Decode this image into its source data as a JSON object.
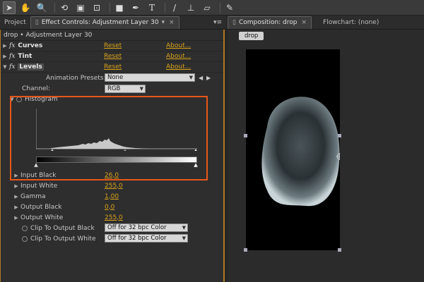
{
  "toolbar": {
    "tools": [
      "selection-tool-icon",
      "hand-tool-icon",
      "zoom-tool-icon",
      "rotate-tool-icon",
      "camera-tool-icon",
      "pan-behind-tool-icon",
      "rectangle-tool-icon",
      "pen-tool-icon",
      "type-tool-icon",
      "brush-tool-icon",
      "clone-stamp-tool-icon",
      "eraser-tool-icon",
      "puppet-pin-tool-icon"
    ]
  },
  "left_tabs": {
    "project": "Project",
    "effect_controls": "Effect Controls: Adjustment Layer 30",
    "menu": "▾≡"
  },
  "right_tabs": {
    "composition": "Composition: drop",
    "flowchart": "Flowchart: (none)"
  },
  "breadcrumb": "drop • Adjustment Layer 30",
  "effects": [
    {
      "name": "Curves",
      "reset": "Reset",
      "about": "About..."
    },
    {
      "name": "Tint",
      "reset": "Reset",
      "about": "About..."
    },
    {
      "name": "Levels",
      "reset": "Reset",
      "about": "About..."
    }
  ],
  "animation_presets": {
    "label": "Animation Presets:",
    "value": "None"
  },
  "channel": {
    "label": "Channel:",
    "value": "RGB"
  },
  "histogram_label": "Histogram",
  "params": [
    {
      "label": "Input Black",
      "value": "26,0"
    },
    {
      "label": "Input White",
      "value": "255,0"
    },
    {
      "label": "Gamma",
      "value": "1,00"
    },
    {
      "label": "Output Black",
      "value": "0,0"
    },
    {
      "label": "Output White",
      "value": "255,0"
    }
  ],
  "clips": [
    {
      "label": "Clip To Output Black",
      "value": "Off for 32 bpc Color"
    },
    {
      "label": "Clip To Output White",
      "value": "Off for 32 bpc Color"
    }
  ],
  "comp_name": "drop",
  "colors": {
    "accent": "#d8a21a",
    "highlight": "#e8571a",
    "panel_border": "#b07a20"
  }
}
